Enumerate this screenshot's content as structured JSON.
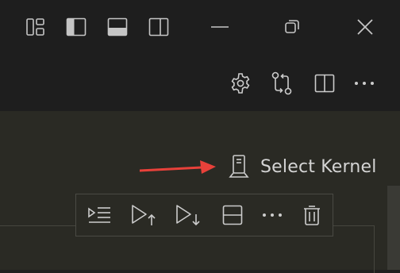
{
  "titlebar": {
    "icons": [
      "customize-layout-icon",
      "toggle-primary-sidebar-icon",
      "toggle-panel-icon",
      "toggle-secondary-sidebar-icon",
      "minimize-icon",
      "restore-icon",
      "close-icon"
    ]
  },
  "editor_actions": {
    "icons": [
      "settings-gear-icon",
      "compare-changes-icon",
      "split-editor-icon",
      "more-actions-icon"
    ]
  },
  "kernel": {
    "label": "Select Kernel",
    "icon": "server-environment-icon"
  },
  "annotation": {
    "arrow_color": "#e8413a"
  },
  "cell_toolbar": {
    "icons": [
      "execute-above-cells-icon",
      "execute-cell-and-above-icon",
      "execute-cell-and-below-icon",
      "split-cell-icon",
      "more-icon",
      "delete-cell-icon"
    ]
  },
  "colors": {
    "titlebar_bg": "#1e1e1e",
    "notebook_bg": "#2a2a24",
    "icon": "#cccccc"
  }
}
